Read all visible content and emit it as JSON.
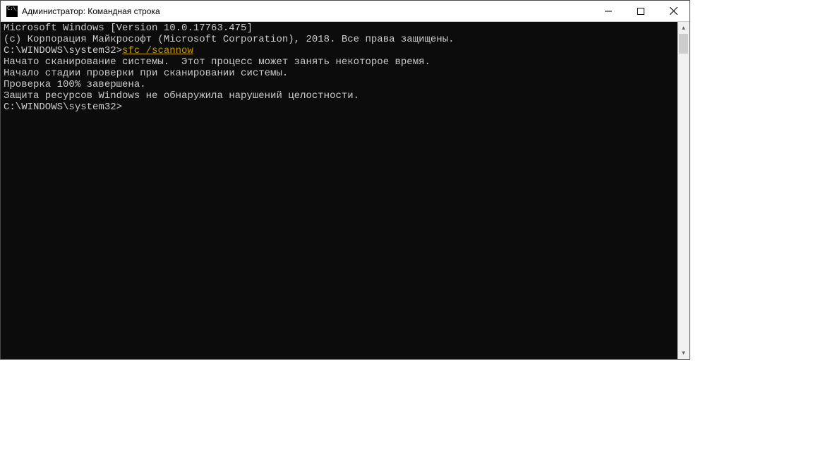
{
  "title": "Администратор: Командная строка",
  "buttons": {
    "min": "—",
    "max": "▢",
    "close": "✕"
  },
  "scroll": {
    "up": "▴",
    "down": "▾"
  },
  "lines": {
    "l0": "Microsoft Windows [Version 10.0.17763.475]",
    "l1": "(c) Корпорация Майкрософт (Microsoft Corporation), 2018. Все права защищены.",
    "l2": "",
    "l3a": "C:\\WINDOWS\\system32>",
    "l3b": "sfc /scannow",
    "l4": "",
    "l5": "Начато сканирование системы.  Этот процесс может занять некоторое время.",
    "l6": "",
    "l7": "Начало стадии проверки при сканировании системы.",
    "l8": "Проверка 100% завершена.",
    "l9": "",
    "l10": "Защита ресурсов Windows не обнаружила нарушений целостности.",
    "l11": "",
    "l12": "C:\\WINDOWS\\system32>"
  }
}
